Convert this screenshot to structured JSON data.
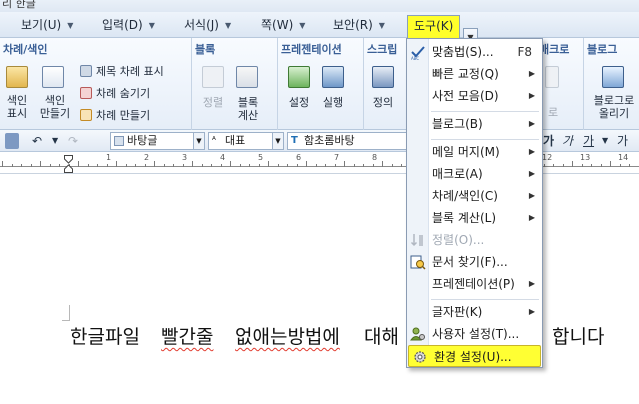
{
  "window": {
    "title_fragment": "리 한글"
  },
  "menubar": {
    "items": [
      {
        "label": "보기(U)"
      },
      {
        "label": "입력(D)"
      },
      {
        "label": "서식(J)"
      },
      {
        "label": "쪽(W)"
      },
      {
        "label": "보안(R)"
      },
      {
        "label": "도구(K)",
        "active": true
      }
    ]
  },
  "ribbon": {
    "toc_group": {
      "title": "차례/색인",
      "index_label_1": "색인",
      "index_label_2": "표시",
      "index_make_1": "색인",
      "index_make_2": "만들기",
      "title_toc": "제목 차례 표시",
      "hide_toc": "차례 숨기기",
      "make_toc": "차례 만들기"
    },
    "block_group": {
      "title": "블록",
      "sort_label": "정렬",
      "calc_label_1": "블록",
      "calc_label_2": "계산"
    },
    "presentation_group": {
      "title": "프레젠테이션",
      "settings_label": "설정",
      "run_label": "실행"
    },
    "script_group": {
      "title": "스크립",
      "define_label": "정의"
    },
    "macro_group": {
      "title": "매크로",
      "label": "로"
    },
    "blog_group": {
      "title": "블로그",
      "upload_label_1": "블로그로",
      "upload_label_2": "올리기"
    }
  },
  "format_bar": {
    "style_value": "바탕글",
    "lang_value": "대표",
    "font_value": "함초롬바탕",
    "style_buttons": [
      "가",
      "가",
      "가",
      "가"
    ]
  },
  "ruler": {
    "numbers": [
      "1",
      "2",
      "3",
      "4",
      "5",
      "6",
      "7",
      "8",
      "12",
      "13",
      "14"
    ]
  },
  "document": {
    "line_part1": "한글파일",
    "line_part2": "빨간줄",
    "line_part3": "없애는방법에",
    "line_part4": "대해",
    "line_part5": "합니다"
  },
  "tools_menu": {
    "items": [
      {
        "label": "맞춤법(S)...",
        "shortcut": "F8",
        "icon": "spell-check-icon",
        "submenu": true
      },
      {
        "label": "빠른 교정(Q)",
        "submenu": true
      },
      {
        "label": "사전 모음(D)",
        "submenu": true
      },
      {
        "label": "블로그(B)",
        "submenu": true
      },
      {
        "label": "메일 머지(M)",
        "submenu": true
      },
      {
        "label": "매크로(A)",
        "submenu": true
      },
      {
        "label": "차례/색인(C)",
        "submenu": true
      },
      {
        "label": "블록 계산(L)",
        "submenu": true
      },
      {
        "label": "정렬(O)...",
        "disabled": true,
        "icon": "sort-icon"
      },
      {
        "label": "문서 찾기(F)...",
        "icon": "document-search-icon"
      },
      {
        "label": "프레젠테이션(P)",
        "submenu": true
      },
      {
        "label": "글자판(K)",
        "submenu": true
      },
      {
        "label": "사용자 설정(T)...",
        "icon": "user-settings-icon"
      },
      {
        "label": "환경 설정(U)...",
        "icon": "gear-icon",
        "highlighted": true
      }
    ]
  },
  "colors": {
    "menu_highlight": "#ffff33",
    "group_title": "#3a5f96",
    "spell_squiggle": "#e13a2e"
  }
}
